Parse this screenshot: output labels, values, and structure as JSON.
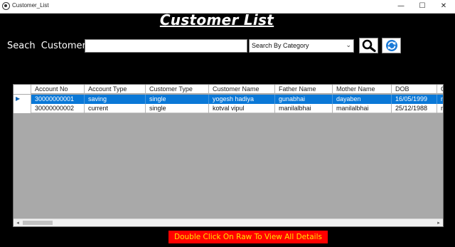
{
  "window": {
    "title": "Customer_List",
    "controls": {
      "minimize": "—",
      "maximize": "☐",
      "close": "✕"
    }
  },
  "header": {
    "title": "Customer List"
  },
  "search": {
    "label": "Seach  Customer",
    "value": "",
    "category_selected": "Search By Category",
    "chevron": "⌄"
  },
  "grid": {
    "row_indicator": "▶",
    "columns": [
      "Account No",
      "Account Type",
      "Customer Type",
      "Customer Name",
      "Father Name",
      "Mother Name",
      "DOB",
      "G"
    ],
    "rows": [
      [
        "30000000001",
        "saving",
        "single",
        "yogesh hadiya",
        "gunabhai",
        "dayaben",
        "16/05/1999",
        "ma"
      ],
      [
        "30000000002",
        "current",
        "single",
        "kotval vipul",
        "manilalbhai",
        "manilalbhai",
        "25/12/1988",
        "ma"
      ]
    ],
    "selected_row": 0,
    "scroll": {
      "left": "◂",
      "right": "▸"
    }
  },
  "footer": {
    "hint": "Double Click On Raw To View All Details"
  },
  "colors": {
    "background": "#000000",
    "selection": "#0a78d7",
    "hint_bg": "#ff0000",
    "hint_text": "#ffe400",
    "refresh_icon": "#1a7ad8"
  }
}
